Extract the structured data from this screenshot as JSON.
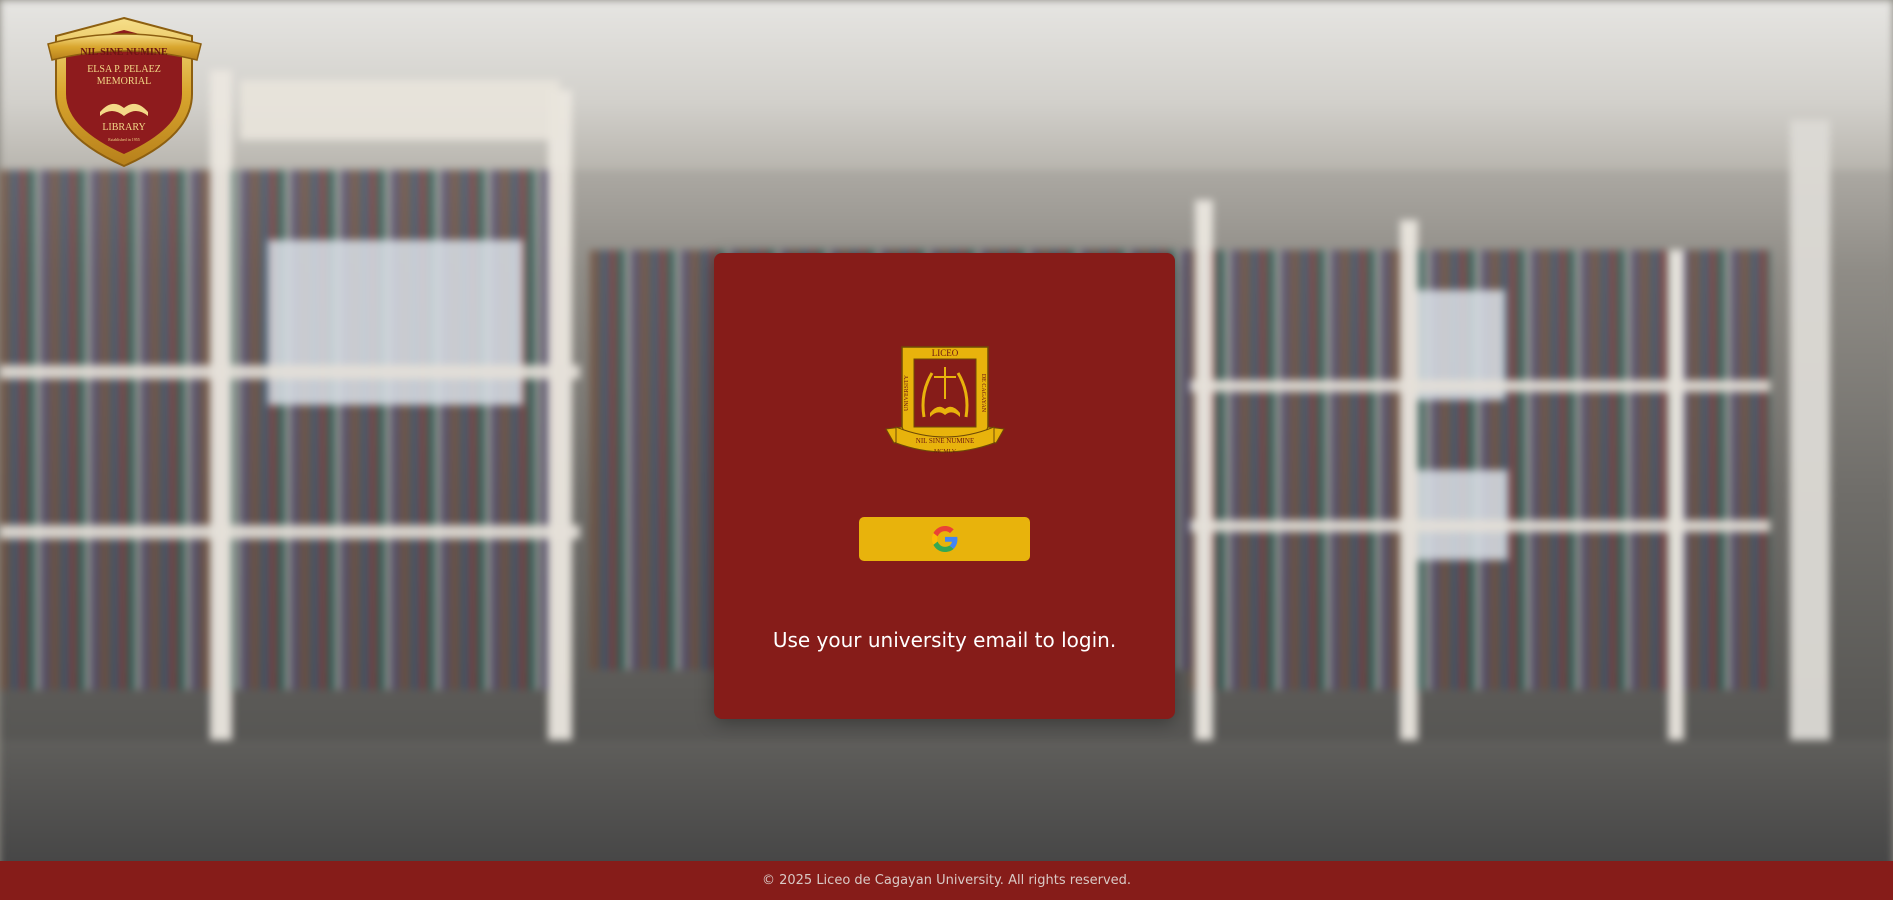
{
  "crest": {
    "icon": "library-crest-icon",
    "motto": "NIL SINE NUMINE",
    "lines": [
      "ELSA P. PELAEZ",
      "MEMORIAL",
      "LIBRARY"
    ],
    "established": "Established in 1955"
  },
  "login": {
    "seal_icon": "university-seal-icon",
    "seal_top": "LICEO",
    "seal_left": "UNIVERSITY",
    "seal_right": "DE CAGAYAN",
    "seal_motto": "NIL SINE NUMINE",
    "seal_year": "MCMLV",
    "google_button_icon": "google-icon",
    "hint": "Use your university email to login."
  },
  "footer": {
    "copyright": "© 2025 Liceo de Cagayan University. All rights reserved."
  },
  "colors": {
    "maroon": "#861c19",
    "gold": "#e8b30c",
    "white": "#ffffff"
  }
}
